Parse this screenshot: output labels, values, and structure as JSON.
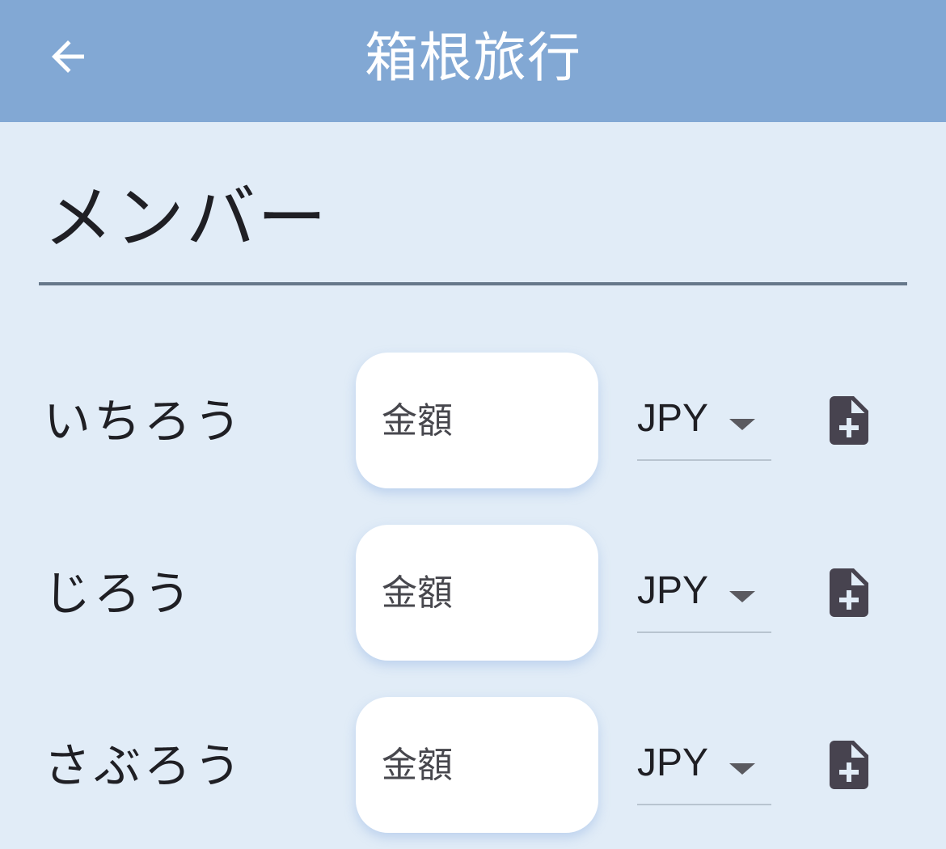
{
  "app_bar": {
    "title": "箱根旅行",
    "back_icon": "arrow-back-icon"
  },
  "section": {
    "title": "メンバー"
  },
  "members": [
    {
      "name": "いちろう",
      "amount_placeholder": "金額",
      "amount_value": "",
      "currency": "JPY",
      "attach_icon": "note-add-icon"
    },
    {
      "name": "じろう",
      "amount_placeholder": "金額",
      "amount_value": "",
      "currency": "JPY",
      "attach_icon": "note-add-icon"
    },
    {
      "name": "さぶろう",
      "amount_placeholder": "金額",
      "amount_value": "",
      "currency": "JPY",
      "attach_icon": "note-add-icon"
    }
  ],
  "colors": {
    "app_bar": "#82a8d4",
    "background": "#e1ecf7",
    "divider": "#66788a",
    "icon": "#47434f"
  }
}
